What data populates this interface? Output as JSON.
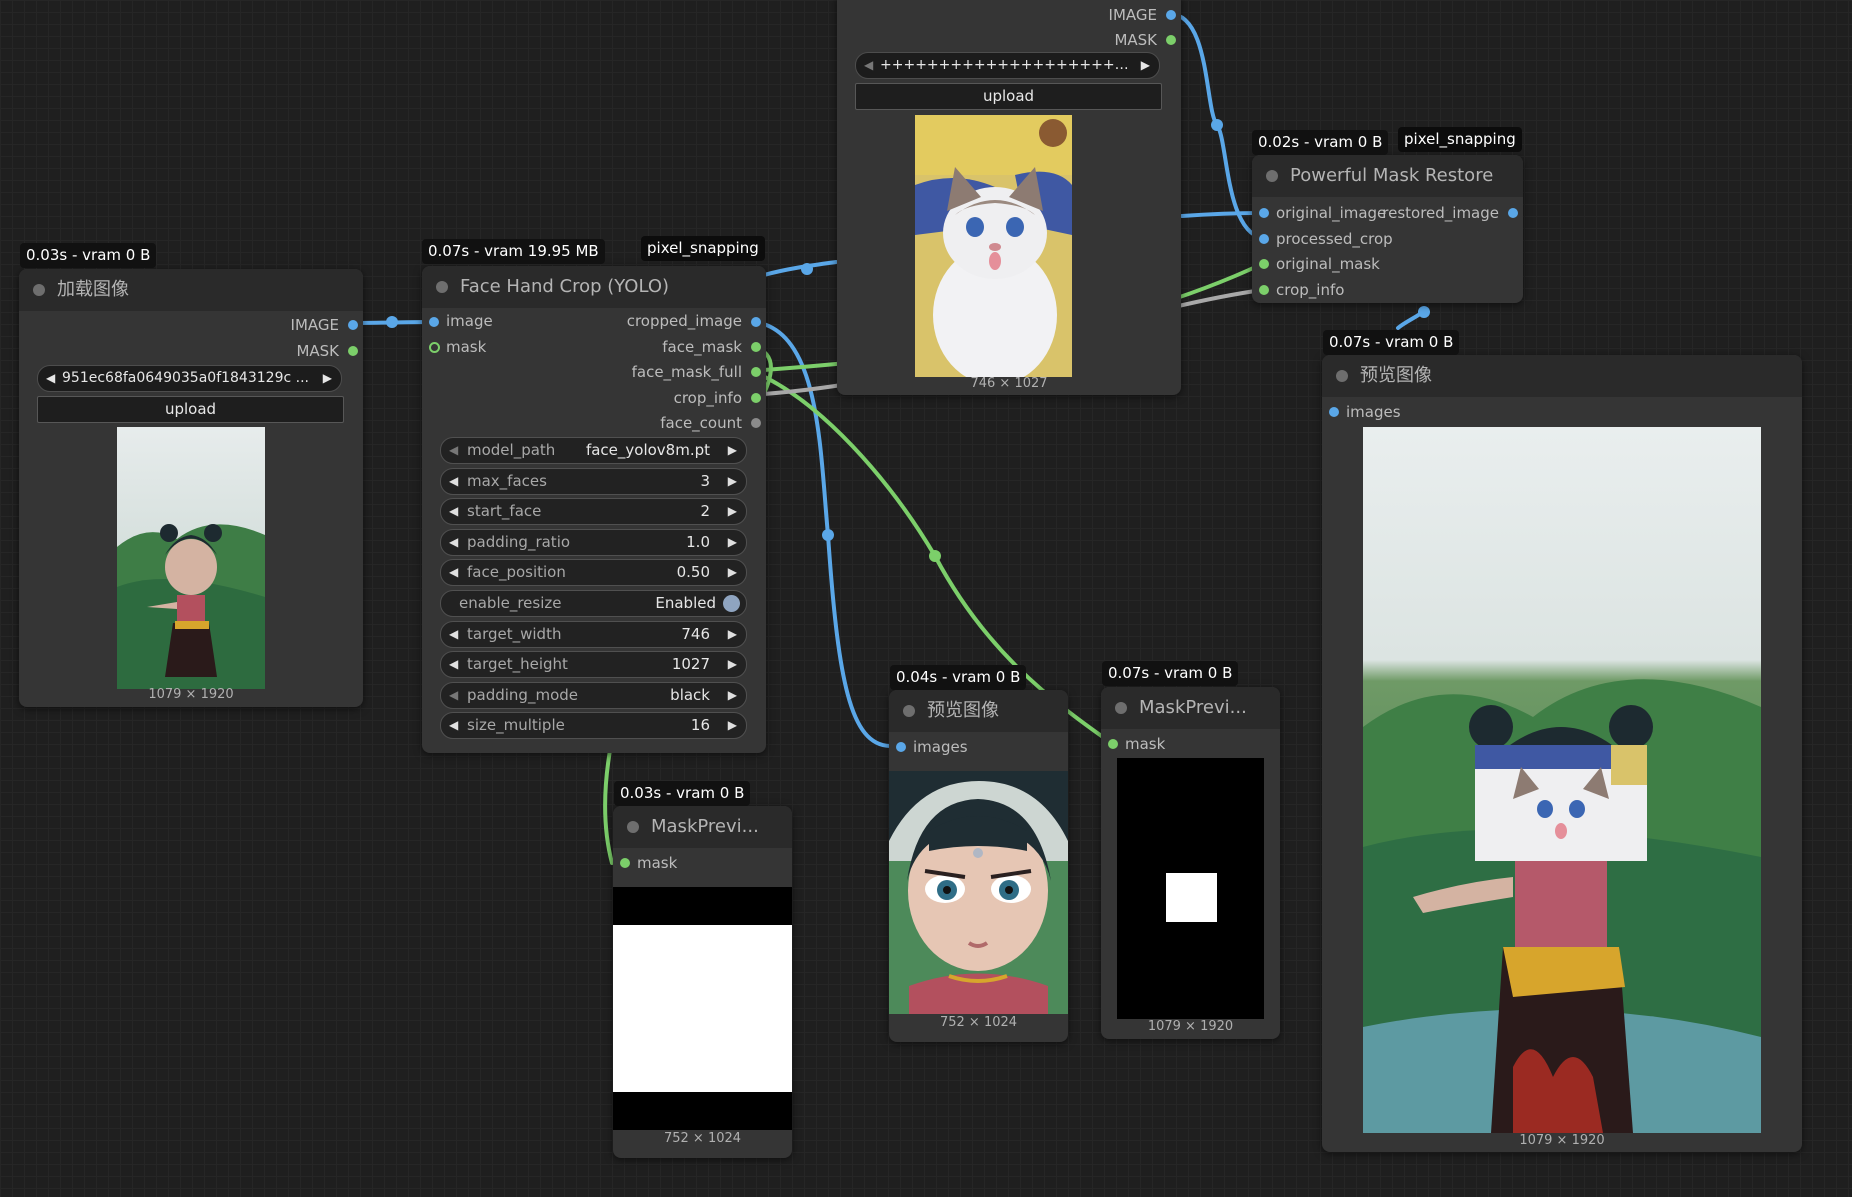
{
  "nodes": {
    "load_image": {
      "badge": "0.03s - vram 0 B",
      "title": "加载图像",
      "outputs": [
        "IMAGE",
        "MASK"
      ],
      "filename": "951ec68fa0649035a0f1843129c ...",
      "upload_label": "upload",
      "dims": "1079 × 1920"
    },
    "face_crop": {
      "badge": "0.07s - vram 19.95 MB",
      "chip": "pixel_snapping",
      "title": "Face Hand Crop (YOLO)",
      "inputs": [
        "image",
        "mask"
      ],
      "outputs": [
        "cropped_image",
        "face_mask",
        "face_mask_full",
        "crop_info",
        "face_count"
      ],
      "widgets": [
        {
          "label": "model_path",
          "value": "face_yolov8m.pt"
        },
        {
          "label": "max_faces",
          "value": "3"
        },
        {
          "label": "start_face",
          "value": "2"
        },
        {
          "label": "padding_ratio",
          "value": "1.0"
        },
        {
          "label": "face_position",
          "value": "0.50"
        },
        {
          "label": "enable_resize",
          "value": "Enabled"
        },
        {
          "label": "target_width",
          "value": "746"
        },
        {
          "label": "target_height",
          "value": "1027"
        },
        {
          "label": "padding_mode",
          "value": "black"
        },
        {
          "label": "size_multiple",
          "value": "16"
        }
      ]
    },
    "load_image_2": {
      "outputs": [
        "IMAGE",
        "MASK"
      ],
      "filename": "++++++++++++++++++++++.j...",
      "upload_label": "upload",
      "dims": "746 × 1027"
    },
    "mask_restore": {
      "badge": "0.02s - vram 0 B",
      "chip": "pixel_snapping",
      "title": "Powerful Mask Restore",
      "inputs": [
        "original_image",
        "processed_crop",
        "original_mask",
        "crop_info"
      ],
      "outputs": [
        "restored_image"
      ]
    },
    "preview_final": {
      "badge": "0.07s - vram 0 B",
      "title": "预览图像",
      "inputs": [
        "images"
      ],
      "dims": "1079 × 1920"
    },
    "preview_crop": {
      "badge": "0.04s - vram 0 B",
      "title": "预览图像",
      "inputs": [
        "images"
      ],
      "dims": "752 × 1024"
    },
    "mask_preview_1": {
      "badge": "0.03s - vram 0 B",
      "title": "MaskPrevi...",
      "inputs": [
        "mask"
      ],
      "dims": "752 × 1024"
    },
    "mask_preview_2": {
      "badge": "0.07s - vram 0 B",
      "title": "MaskPrevi...",
      "inputs": [
        "mask"
      ],
      "dims": "1079 × 1920"
    }
  },
  "colors": {
    "image_link": "#5aa7e8",
    "mask_link": "#7ccf6a",
    "info_link": "#a8a8a8",
    "canvas": "#1f1f1f",
    "node_body": "#353535"
  }
}
